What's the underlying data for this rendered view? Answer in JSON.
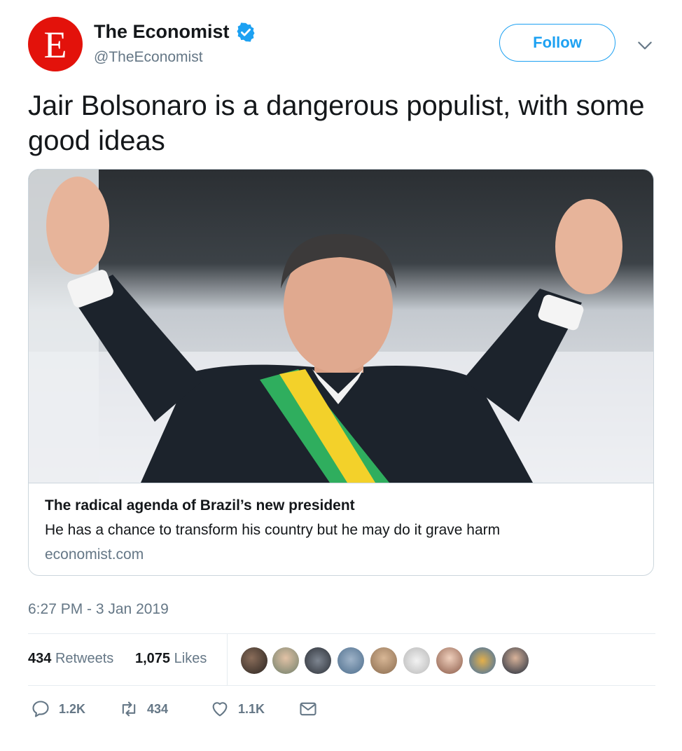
{
  "author": {
    "avatar_letter": "E",
    "display_name": "The Economist",
    "handle": "@TheEconomist",
    "brand_color": "#e3120b"
  },
  "follow_label": "Follow",
  "tweet_text": "Jair Bolsonaro is a dangerous populist, with some good ideas",
  "card": {
    "title": "The radical agenda of Brazil’s new president",
    "description": "He has a chance to transform his country but he may do it grave harm",
    "domain": "economist.com"
  },
  "timestamp": "6:27 PM - 3 Jan 2019",
  "stats": {
    "retweets_count": "434",
    "retweets_label": "Retweets",
    "likes_count": "1,075",
    "likes_label": "Likes"
  },
  "actions": {
    "replies": "1.2K",
    "retweets": "434",
    "likes": "1.1K"
  },
  "colors": {
    "accent": "#1da1f2",
    "secondary_text": "#657786",
    "border": "#ccd6dd"
  }
}
